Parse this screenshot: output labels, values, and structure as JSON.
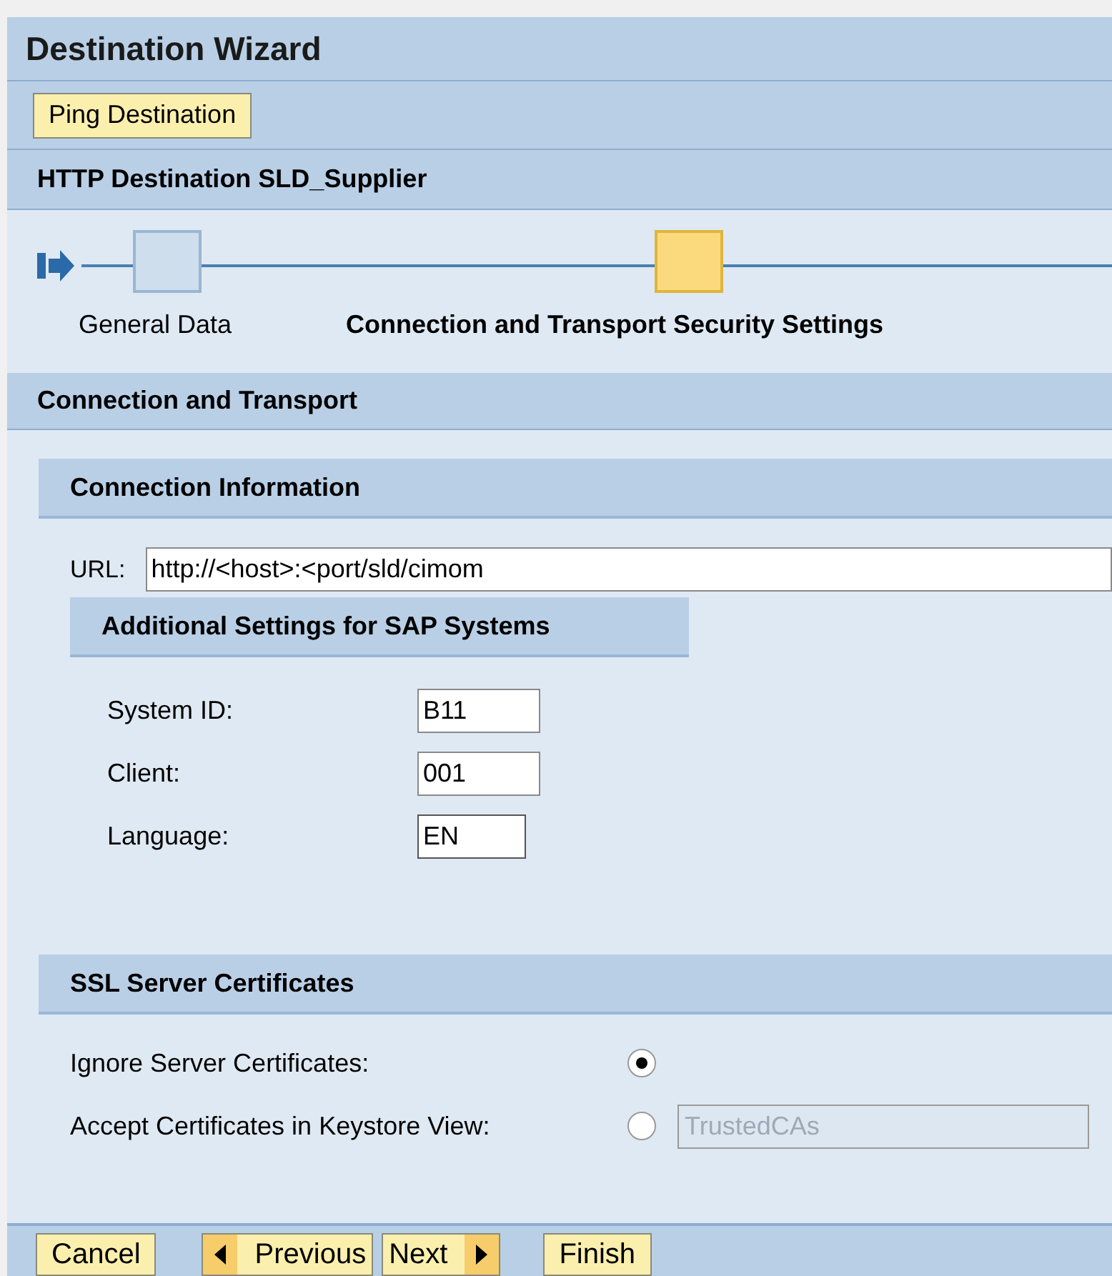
{
  "window": {
    "title": "Destination Wizard"
  },
  "toolbar": {
    "buttons": [
      "Ping Destination"
    ]
  },
  "subtitle": "HTTP Destination SLD_Supplier",
  "roadmap": {
    "steps": [
      {
        "label": "General Data",
        "selected": false
      },
      {
        "label": "Connection and Transport Security Settings",
        "selected": true
      }
    ]
  },
  "section": {
    "title": "Connection and Transport"
  },
  "connection": {
    "title": "Connection Information",
    "url_label": "URL:",
    "url_value": "http://<host>:<port/sld/cimom"
  },
  "sap_settings": {
    "title": "Additional Settings for SAP Systems",
    "fields": [
      {
        "label": "System ID:",
        "value": "B11",
        "focused": false
      },
      {
        "label": "Client:",
        "value": "001",
        "focused": false
      },
      {
        "label": "Language:",
        "value": "EN",
        "focused": true
      }
    ]
  },
  "ssl": {
    "title": "SSL Server Certificates",
    "options": [
      {
        "label": "Ignore Server Certificates:",
        "selected": true
      },
      {
        "label": "Accept Certificates in Keystore View:",
        "selected": false,
        "field_value": "TrustedCAs",
        "field_disabled": true
      }
    ]
  },
  "footer": {
    "buttons": [
      {
        "label": "Cancel",
        "kind": "plain"
      },
      {
        "label": "Previous",
        "kind": "back"
      },
      {
        "label": "Next",
        "kind": "forward"
      },
      {
        "label": "Finish",
        "kind": "plain"
      }
    ]
  }
}
